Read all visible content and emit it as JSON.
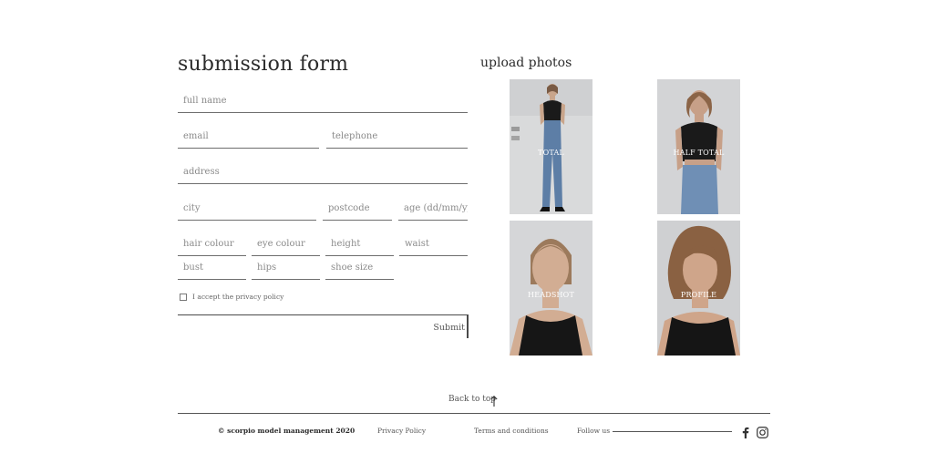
{
  "form": {
    "title": "submission form",
    "fields": {
      "full_name": "full name",
      "email": "email",
      "telephone": "telephone",
      "address": "address",
      "city": "city",
      "postcode": "postcode",
      "age": "age (dd/mm/yyy",
      "hair_colour": "hair colour",
      "eye_colour": "eye colour",
      "height": "height",
      "waist": "waist",
      "bust": "bust",
      "hips": "hips",
      "shoe_size": "shoe size"
    },
    "privacy_label": "I accept the privacy policy",
    "submit_label": "Submit"
  },
  "upload": {
    "title": "upload photos",
    "photos": [
      {
        "label": "TOTAL"
      },
      {
        "label": "HALF TOTAL"
      },
      {
        "label": "HEADSHOT"
      },
      {
        "label": "PROFILE"
      }
    ]
  },
  "footer": {
    "back_to_top": "Back to top",
    "copyright": "© scorpio model management 2020",
    "privacy": "Privacy Policy",
    "terms": "Terms and conditions",
    "follow": "Follow us",
    "social_icons": [
      "facebook-icon",
      "instagram-icon"
    ]
  }
}
